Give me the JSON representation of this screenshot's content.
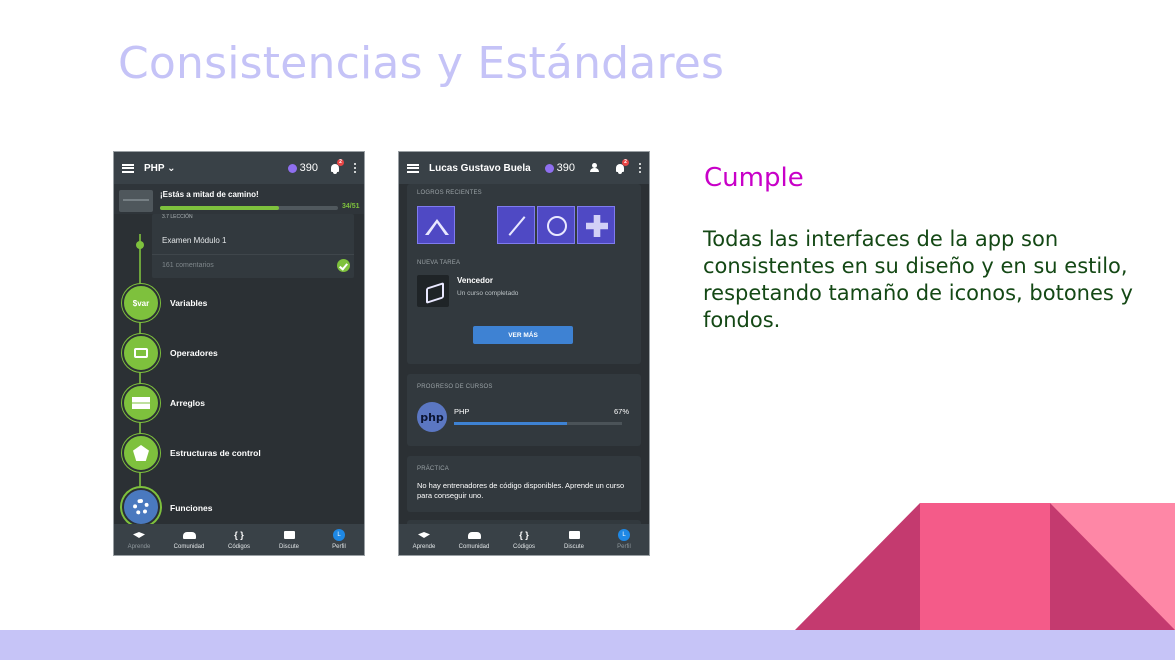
{
  "slide": {
    "title": "Consistencias y Estándares",
    "status": "Cumple",
    "description": "Todas las interfaces de la app son consistentes en su diseño y en su estilo, respetando tamaño  de iconos, botones y fondos."
  },
  "phone1": {
    "topbar": {
      "title": "PHP ⌄",
      "xp": "390"
    },
    "progress": {
      "title": "¡Estás a mitad de camino!",
      "count": "34/51",
      "fraction": 0.667
    },
    "lesson": {
      "cut_text": "3.7 LECCIÓN",
      "title": "Examen Módulo 1",
      "comments": "161 comentarios"
    },
    "courses": [
      {
        "icon_text": "$var",
        "label": "Variables"
      },
      {
        "icon_text": "",
        "label": "Operadores"
      },
      {
        "icon_text": "",
        "label": "Arreglos"
      },
      {
        "icon_text": "",
        "label": "Estructuras de control"
      },
      {
        "icon_text": "",
        "label": "Funciones"
      }
    ]
  },
  "phone2": {
    "topbar": {
      "title": "Lucas Gustavo Buela",
      "xp": "390"
    },
    "achievements_label": "LOGROS RECIENTES",
    "task_label": "NUEVA TAREA",
    "task": {
      "title": "Vencedor",
      "subtitle": "Un curso completado"
    },
    "more_button": "VER MÁS",
    "progress_label": "PROGRESO DE CURSOS",
    "course": {
      "badge": "php",
      "name": "PHP",
      "percent": "67%",
      "fraction": 0.67
    },
    "practice_label": "PRÁCTICA",
    "practice_text": "No hay entrenadores de código disponibles. Aprende un curso para conseguir uno."
  },
  "nav": {
    "items": [
      "Aprende",
      "Comunidad",
      "Códigos",
      "Discute",
      "Perfil"
    ],
    "avatar_letter": "L",
    "notification_count": "2"
  },
  "colors": {
    "title": "#c5c3f7",
    "status": "#c800c8",
    "description": "#144815",
    "app_bg": "#2b3034",
    "app_bar": "#394147",
    "accent_green": "#7ec13d",
    "accent_blue": "#3e82d3",
    "deco_pink": "#f45b89",
    "deco_magenta": "#c43a6f",
    "deco_light": "#fe87a6",
    "footer": "#c6c4f7"
  }
}
